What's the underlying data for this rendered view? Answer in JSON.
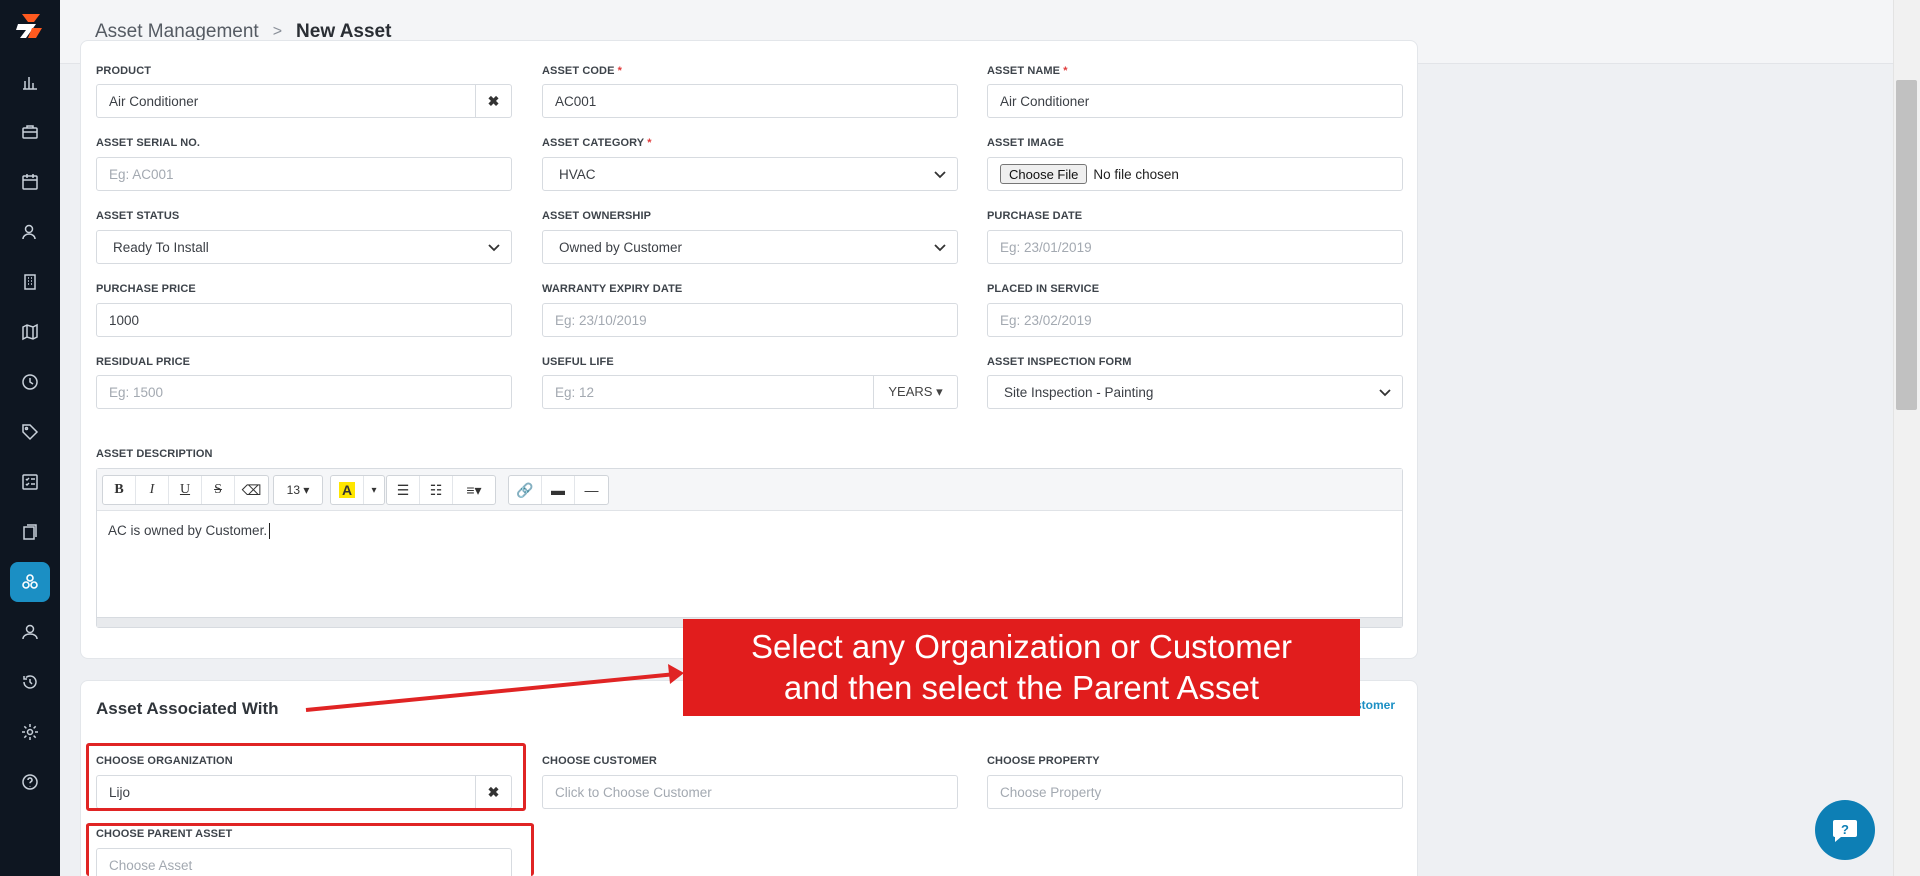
{
  "breadcrumb": {
    "parent": "Asset Management",
    "separator": ">",
    "current": "New Asset"
  },
  "colors": {
    "sidebar": "#0e1621",
    "accent": "#1b8fc4",
    "callout": "#e11d1d",
    "required": "#e03b3b"
  },
  "sidebar": {
    "items": [
      {
        "icon": "bar-chart-icon"
      },
      {
        "icon": "briefcase-icon"
      },
      {
        "icon": "calendar-icon"
      },
      {
        "icon": "user-search-icon"
      },
      {
        "icon": "building-icon"
      },
      {
        "icon": "map-icon"
      },
      {
        "icon": "clock-icon"
      },
      {
        "icon": "tag-icon"
      },
      {
        "icon": "checklist-icon"
      },
      {
        "icon": "documents-icon"
      },
      {
        "icon": "assets-icon"
      },
      {
        "icon": "user-icon"
      },
      {
        "icon": "history-icon"
      },
      {
        "icon": "gear-icon"
      },
      {
        "icon": "help-icon"
      }
    ]
  },
  "form": {
    "product": {
      "label": "PRODUCT",
      "value": "Air Conditioner",
      "clear": "✖"
    },
    "asset_code": {
      "label": "ASSET CODE",
      "req": "*",
      "value": "AC001"
    },
    "asset_name": {
      "label": "ASSET NAME",
      "req": "*",
      "value": "Air Conditioner"
    },
    "serial_no": {
      "label": "ASSET SERIAL NO.",
      "placeholder": "Eg: AC001"
    },
    "category": {
      "label": "ASSET CATEGORY",
      "req": "*",
      "value": "HVAC"
    },
    "image": {
      "label": "ASSET IMAGE",
      "button": "Choose File",
      "status": "No file chosen"
    },
    "status": {
      "label": "ASSET STATUS",
      "value": "Ready To Install"
    },
    "ownership": {
      "label": "ASSET OWNERSHIP",
      "value": "Owned by Customer"
    },
    "purchase_date": {
      "label": "PURCHASE DATE",
      "placeholder": "Eg: 23/01/2019"
    },
    "purchase_price": {
      "label": "PURCHASE PRICE",
      "value": "1000"
    },
    "warranty": {
      "label": "WARRANTY EXPIRY DATE",
      "placeholder": "Eg: 23/10/2019"
    },
    "placed_in_service": {
      "label": "PLACED IN SERVICE",
      "placeholder": "Eg: 23/02/2019"
    },
    "residual_price": {
      "label": "RESIDUAL PRICE",
      "placeholder": "Eg: 1500"
    },
    "useful_life": {
      "label": "USEFUL LIFE",
      "placeholder": "Eg: 12",
      "unit": "YEARS ▾"
    },
    "inspection_form": {
      "label": "ASSET INSPECTION FORM",
      "value": "Site Inspection - Painting"
    },
    "description": {
      "label": "ASSET DESCRIPTION",
      "text": "AC is owned by Customer.",
      "font_size": "13 ▾"
    }
  },
  "associated": {
    "title": "Asset Associated With",
    "link": "stomer",
    "organization": {
      "label": "CHOOSE ORGANIZATION",
      "value": "Lijo",
      "clear": "✖"
    },
    "customer": {
      "label": "CHOOSE CUSTOMER",
      "placeholder": "Click to Choose Customer"
    },
    "property": {
      "label": "CHOOSE PROPERTY",
      "placeholder": "Choose Property"
    },
    "parent_asset": {
      "label": "CHOOSE PARENT ASSET",
      "placeholder": "Choose Asset"
    }
  },
  "callout": {
    "line1": "Select any Organization or Customer",
    "line2": "and then select the Parent Asset"
  }
}
